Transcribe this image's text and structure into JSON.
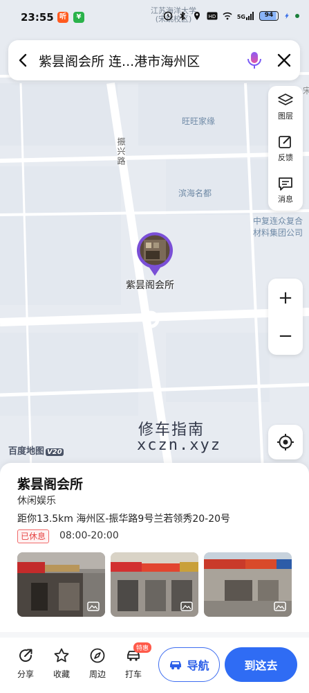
{
  "status_bar": {
    "time": "23:55",
    "faint_label_line1": "江苏海洋大学",
    "faint_label_line2": "(宋跳校区)",
    "network": "5G",
    "battery": "94"
  },
  "search": {
    "text": "紫昙阁会所 连...港市海州区"
  },
  "map": {
    "labels": {
      "wangwang": "旺旺家缘",
      "binhai": "滨海名都",
      "zhongfu_line1": "中复连众复合",
      "zhongfu_line2": "材料集团公司",
      "road": "振兴路",
      "edge_char": "宋"
    },
    "poi_name": "紫昙阁会所",
    "watermark_cn": "修车指南",
    "watermark_en": "xczn.xyz",
    "logo_text": "百度地图",
    "logo_version": "V20"
  },
  "tools": {
    "layers": "图层",
    "feedback": "反馈",
    "messages": "消息",
    "zoom_in": "+",
    "zoom_out": "−"
  },
  "place": {
    "name": "紫昙阁会所",
    "category": "休闲娱乐",
    "address": "距你13.5km  海州区-振华路9号兰若领秀20-20号",
    "status": "已休息",
    "hours": "08:00-20:00"
  },
  "bottom_bar": {
    "share": "分享",
    "favorite": "收藏",
    "nearby": "周边",
    "taxi": "打车",
    "taxi_badge": "特惠",
    "navigate": "导航",
    "go_here": "到这去"
  },
  "colors": {
    "accent": "#2f6cf4",
    "poi_purple": "#7a4fd6",
    "closed_red": "#e64545"
  }
}
